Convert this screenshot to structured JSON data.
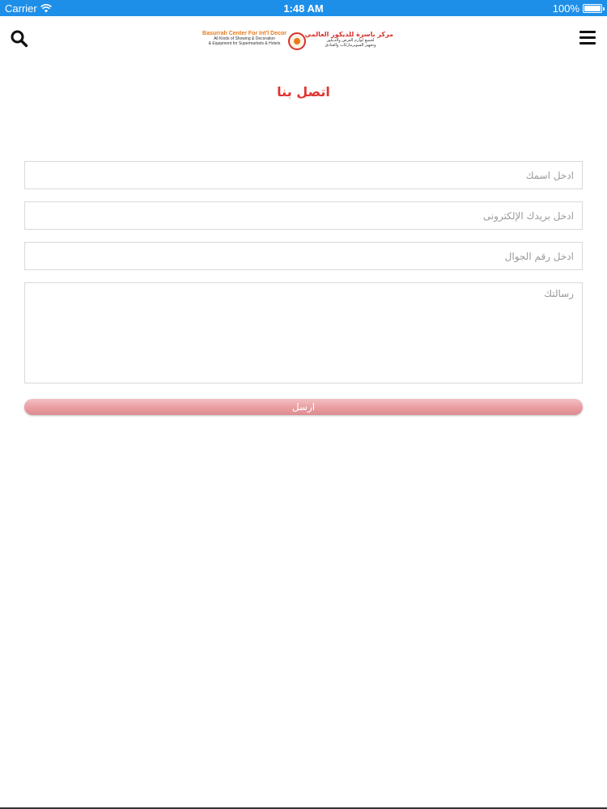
{
  "status_bar": {
    "carrier": "Carrier",
    "time": "1:48 AM",
    "battery": "100%"
  },
  "logo": {
    "english_title": "Basurrah Center For Int'l Decor",
    "english_subtitle_1": "All Kinds of Showing & Decoration",
    "english_subtitle_2": "& Equipment for Supermarkets & Hotels",
    "arabic_title": "مركز باسرة للديكور العالمي",
    "arabic_subtitle_1": "لجميع لوازم العرض والديكور",
    "arabic_subtitle_2": "وتجهيز السوبرماركات والفنادق"
  },
  "page": {
    "title": "اتصل بنا"
  },
  "form": {
    "name_placeholder": "ادخل اسمك",
    "email_placeholder": "ادخل بريدك الإلكترونى",
    "phone_placeholder": "ادخل رقم الجوال",
    "message_placeholder": "رسالتك",
    "submit_label": "ارسل"
  },
  "icons": {
    "search": "search-icon",
    "menu": "hamburger-menu-icon",
    "wifi": "wifi-icon",
    "battery": "battery-icon"
  },
  "colors": {
    "status_bar": "#1e8fe8",
    "title_red": "#e0342f",
    "button_pink": "#e89da1",
    "logo_orange": "#e87a1c"
  }
}
